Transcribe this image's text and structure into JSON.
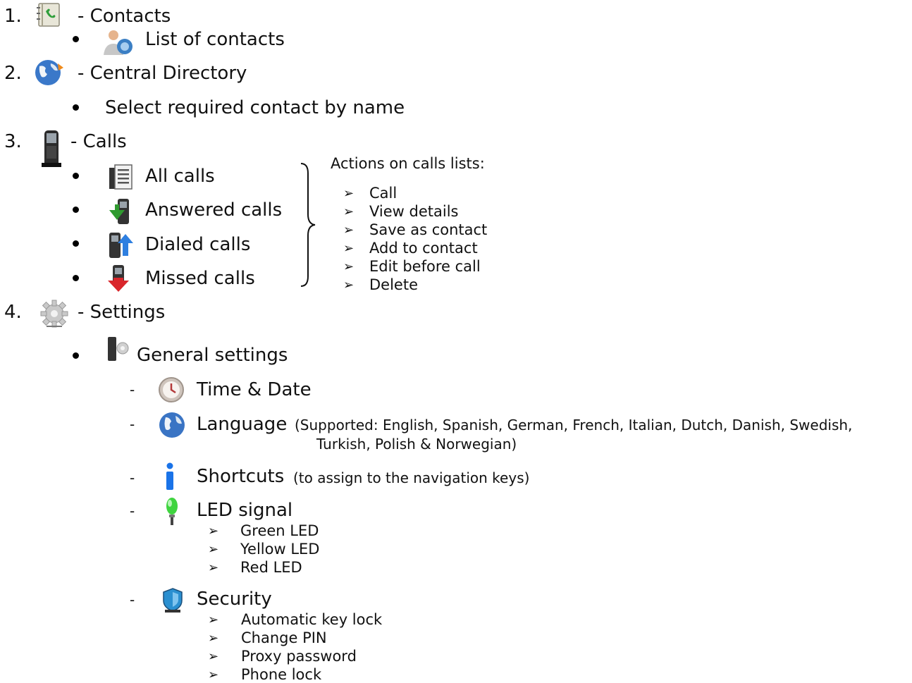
{
  "sections": {
    "contacts": {
      "number": "1.",
      "title": "- Contacts",
      "icon": "address-book-icon",
      "items": [
        {
          "label": "List of contacts",
          "icon": "contacts-list-icon"
        }
      ]
    },
    "directory": {
      "number": "2.",
      "title": "- Central Directory",
      "icon": "globe-directory-icon",
      "items": [
        {
          "label": "Select required contact by name"
        }
      ]
    },
    "calls": {
      "number": "3.",
      "title": "- Calls",
      "icon": "handset-icon",
      "items": [
        {
          "label": "All calls",
          "icon": "all-calls-icon"
        },
        {
          "label": "Answered calls",
          "icon": "answered-calls-icon"
        },
        {
          "label": "Dialed calls",
          "icon": "dialed-calls-icon"
        },
        {
          "label": "Missed calls",
          "icon": "missed-calls-icon"
        }
      ],
      "actions_title": "Actions on calls lists:",
      "actions": [
        "Call",
        "View details",
        "Save as contact",
        "Add to contact",
        "Edit before call",
        "Delete"
      ]
    },
    "settings": {
      "number": "4.",
      "title": "- Settings",
      "icon": "gear-icon",
      "general": {
        "label": "General settings",
        "icon": "general-settings-icon"
      },
      "time": {
        "label": "Time & Date",
        "icon": "clock-icon"
      },
      "language": {
        "label": "Language",
        "note_line1": "(Supported: English, Spanish, German, French, Italian, Dutch, Danish, Swedish,",
        "note_line2": "Turkish, Polish & Norwegian)",
        "icon": "globe-icon"
      },
      "shortcuts": {
        "label": "Shortcuts",
        "note": "(to assign to the navigation keys)",
        "icon": "info-icon"
      },
      "led": {
        "label": "LED signal",
        "icon": "led-icon",
        "items": [
          "Green LED",
          "Yellow LED",
          "Red LED"
        ]
      },
      "security": {
        "label": "Security",
        "icon": "security-shield-icon",
        "items": [
          "Automatic key lock",
          "Change PIN",
          "Proxy password",
          "Phone lock"
        ]
      }
    }
  },
  "glyphs": {
    "arrow": "➢",
    "dash": "-"
  },
  "colors": {
    "green_led": "#3fd43f",
    "info_blue": "#1a73e8",
    "missed_red": "#d9262b",
    "answered_green": "#2f9a2f",
    "dialed_blue": "#2e7fe0"
  }
}
